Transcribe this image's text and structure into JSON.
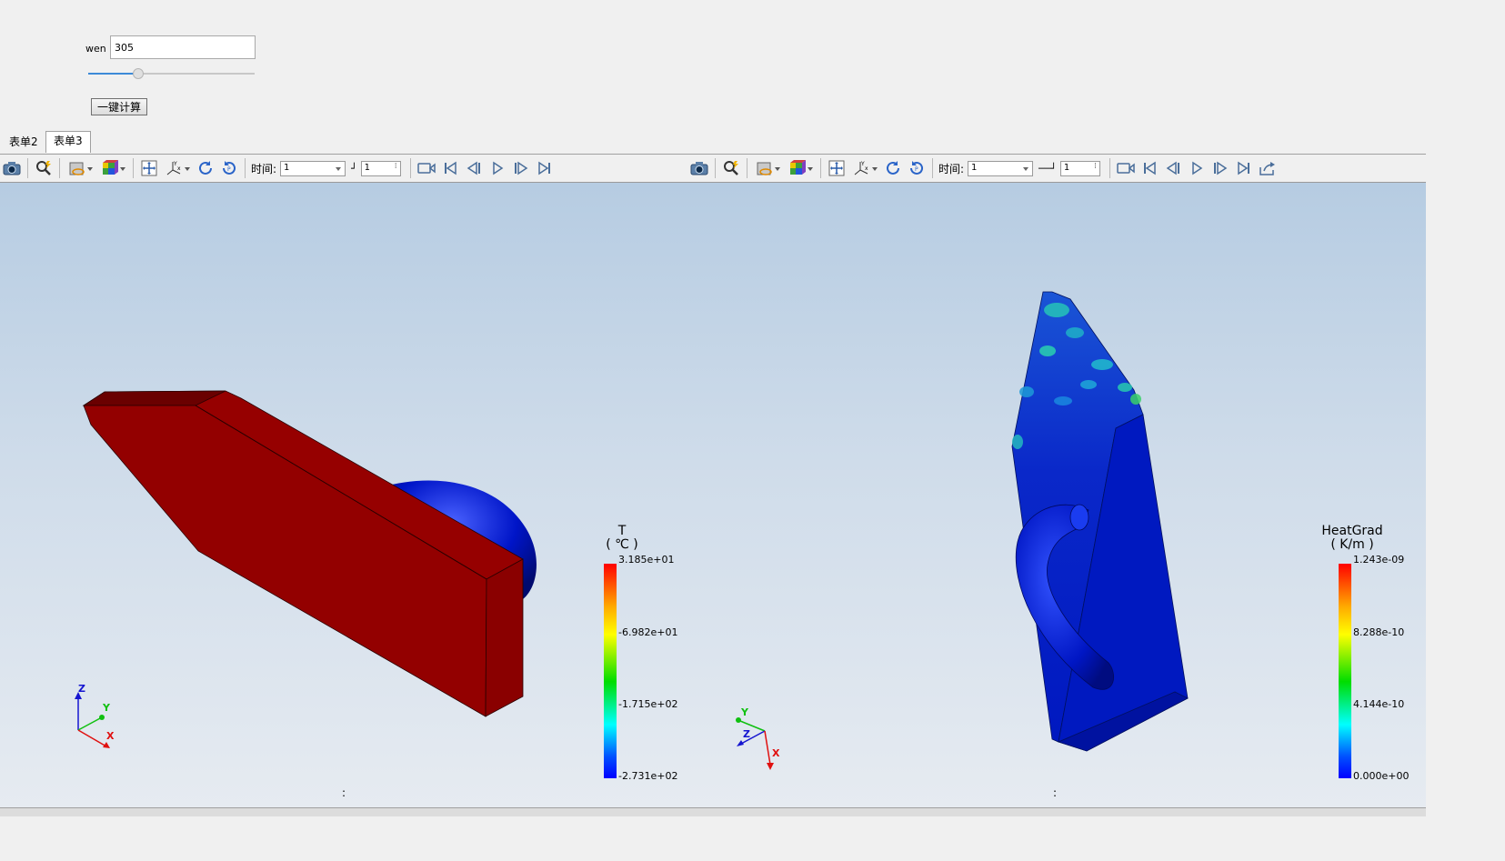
{
  "form": {
    "wen_label": "wen",
    "wen_value": "305",
    "slider_value_fraction": 0.3,
    "calc_button": "一键计算"
  },
  "tabs": [
    {
      "label": "表单2",
      "active": false
    },
    {
      "label": "表单3",
      "active": true
    }
  ],
  "toolbar": {
    "time_label": "时间:",
    "time_value": "1",
    "step_value": "1",
    "icons": [
      "camera-icon",
      "zoom-icon",
      "display-style-icon",
      "color-cube-icon",
      "fit-view-icon",
      "axes-orient-icon",
      "rotate-cw-icon",
      "rotate-ccw-icon",
      "record-icon",
      "first-frame-icon",
      "prev-frame-icon",
      "play-icon",
      "next-frame-icon",
      "last-frame-icon",
      "export-icon"
    ]
  },
  "viewports": {
    "left": {
      "legend": {
        "title": "T",
        "unit": "( ℃ )",
        "ticks": [
          "3.185e+01",
          "-6.982e+01",
          "-1.715e+02",
          "-2.731e+02"
        ]
      },
      "axes": [
        "Z",
        "Y",
        "X"
      ],
      "footer": ":"
    },
    "right": {
      "legend": {
        "title": "HeatGrad",
        "unit": "( K/m )",
        "ticks": [
          "1.243e-09",
          "8.288e-10",
          "4.144e-10",
          "0.000e+00"
        ]
      },
      "axes": [
        "Y",
        "Z",
        "X"
      ],
      "footer": ":"
    }
  },
  "colors": {
    "solid_red": "#930000",
    "solid_blue": "#0019c4",
    "viewport_top": "#b6cce2",
    "viewport_bottom": "#e6ebf1"
  }
}
